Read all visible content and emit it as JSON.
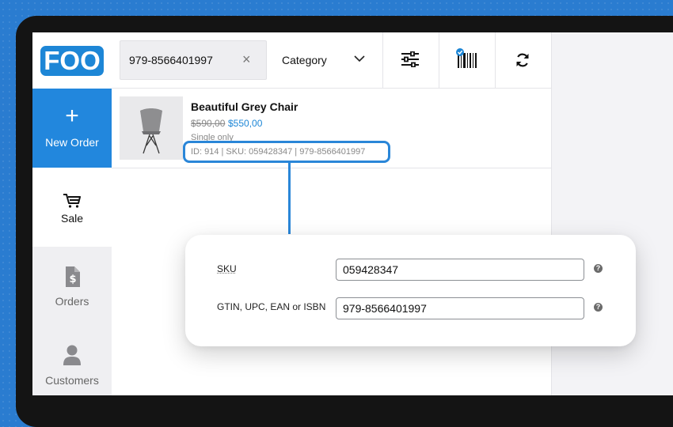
{
  "logo": {
    "text": "FOO"
  },
  "sidebar": {
    "items": [
      {
        "label": "New Order",
        "icon": "plus-icon"
      },
      {
        "label": "Sale",
        "icon": "cart-icon"
      },
      {
        "label": "Orders",
        "icon": "document-dollar-icon"
      },
      {
        "label": "Customers",
        "icon": "user-icon"
      }
    ]
  },
  "topbar": {
    "search_value": "979-8566401997",
    "clear_icon": "×",
    "category_label": "Category"
  },
  "product": {
    "name": "Beautiful Grey Chair",
    "old_price": "$590,00",
    "new_price": "$550,00",
    "note": "Single only",
    "meta": "ID: 914 | SKU: 059428347 | 979-8566401997"
  },
  "details": {
    "sku_label": "SKU",
    "sku_value": "059428347",
    "gtin_label": "GTIN, UPC, EAN or ISBN",
    "gtin_value": "979-8566401997",
    "help": "?"
  },
  "colors": {
    "accent": "#1d86d6",
    "highlight": "#2a86d8"
  }
}
